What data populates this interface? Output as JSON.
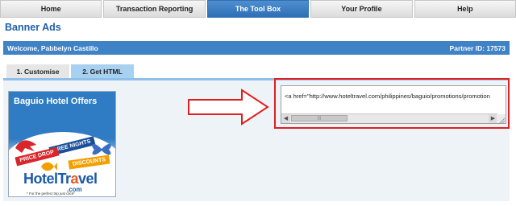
{
  "nav": {
    "tabs": [
      {
        "label": "Home"
      },
      {
        "label": "Transaction Reporting"
      },
      {
        "label": "The Tool Box"
      },
      {
        "label": "Your Profile"
      },
      {
        "label": "Help"
      }
    ],
    "active_tab": "The Tool Box"
  },
  "page": {
    "title": "Banner Ads",
    "welcome": "Welcome, Pabbelyn Castillo",
    "partner_id": "Partner ID: 17573"
  },
  "steps": {
    "tabs": [
      {
        "label": "1. Customise"
      },
      {
        "label": "2. Get HTML"
      }
    ],
    "active": "2. Get HTML"
  },
  "banner": {
    "title": "Baguio Hotel Offers",
    "ribbons": [
      "FREE NIGHTS",
      "PRICE DROP",
      "DISCOUNTS"
    ],
    "logo_main": "HotelTr",
    "logo_accent": "a",
    "logo_end": "vel",
    "logo_suffix": ".com",
    "tagline": "* For the perfect trip just click*"
  },
  "code": {
    "value": "<a href=\"http://www.hoteltravel.com/philippines/baguio/promotions/promotion"
  },
  "colors": {
    "accent_blue": "#3f82c6",
    "highlight_red": "#e02020",
    "title_blue": "#1f5fa6"
  }
}
